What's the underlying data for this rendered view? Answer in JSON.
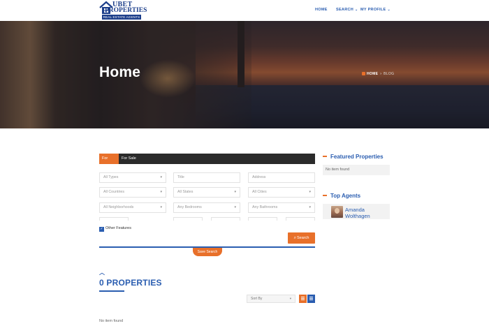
{
  "header": {
    "brand": {
      "line1": "UBET",
      "line2": "PROPERTIES",
      "tagline": "REAL ESTATE AGENTS"
    },
    "nav": [
      {
        "label": "HOME",
        "has_dropdown": false
      },
      {
        "label": "SEARCH",
        "has_dropdown": true
      },
      {
        "label": "MY PROFILE",
        "has_dropdown": true
      }
    ]
  },
  "hero": {
    "title": "Home",
    "breadcrumb": {
      "home": "HOME",
      "separator": "›",
      "current": "BLOG"
    }
  },
  "search": {
    "tabs": [
      "For Rent",
      "For Sale"
    ],
    "active_tab": "For Rent",
    "fields": {
      "types": "All Types",
      "title": "Title",
      "address": "Address",
      "countries": "All Countries",
      "states": "All States",
      "cities": "All Cities",
      "neighborhoods": "All Neighborhoods",
      "bedrooms": "Any Bedrooms",
      "bathrooms": "Any Bathrooms"
    },
    "other_features": {
      "label": "Other Features",
      "checked": true
    },
    "search_button": "Search",
    "save_button": "Save Search"
  },
  "properties": {
    "title": "0 PROPERTIES",
    "sort_label": "Sort By",
    "empty_message": "No item found"
  },
  "sidebar": {
    "featured_title": "Featured Properties",
    "featured_empty": "No item found",
    "agents_title": "Top Agents",
    "agents": [
      {
        "name": "Amanda Wolthagen"
      }
    ]
  },
  "colors": {
    "brand_blue": "#2a5db0",
    "accent_orange": "#e8702a",
    "tab_dark": "#2b2b2b"
  }
}
